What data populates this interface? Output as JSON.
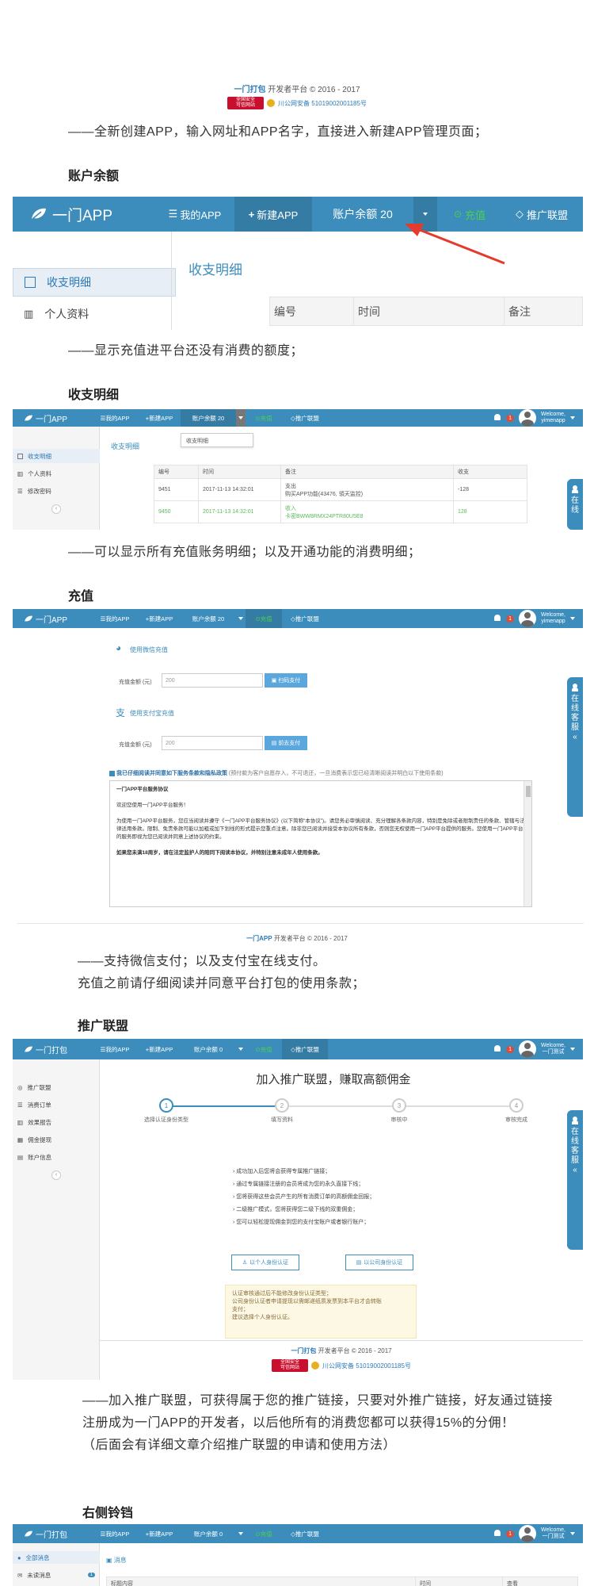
{
  "footer1": {
    "brand": "一门打包",
    "text": "开发者平台 © 2016 - 2017",
    "gov_badge": "全国安全\n可信网站",
    "beian": "川公网安备 51019002001185号"
  },
  "intro_text": "——全新创建APP，输入网址和APP名字，直接进入新建APP管理页面；",
  "balance": {
    "heading": "账户余额",
    "nav": {
      "logo": "一门APP",
      "my_app": "我的APP",
      "new_app": "新建APP",
      "balance": "账户余额 20",
      "recharge": "充值",
      "affiliate": "推广联盟"
    },
    "sidebar": [
      "收支明细",
      "个人资料"
    ],
    "content_title": "收支明细",
    "table_headers": [
      "编号",
      "时间",
      "备注"
    ],
    "desc": "——显示充值进平台还没有消费的额度；"
  },
  "ledger": {
    "heading": "收支明细",
    "nav": {
      "logo": "一门APP",
      "my_app": "我的APP",
      "new_app": "新建APP",
      "balance": "账户余额 20",
      "recharge": "充值",
      "affiliate": "推广联盟",
      "badge": "1",
      "welcome": "Welcome,",
      "user": "yimenapp"
    },
    "dropdown": "收支明细",
    "sidebar": [
      "收支明细",
      "个人资料",
      "修改密码"
    ],
    "content_title": "收支明细",
    "table_headers": [
      "编号",
      "时间",
      "备注",
      "收支"
    ],
    "rows": [
      {
        "id": "9451",
        "time": "2017-11-13 14:32:01",
        "note1": "支出",
        "note2": "购买APP功能(43476, 領天监控)",
        "amount": "-128"
      },
      {
        "id": "9450",
        "time": "2017-11-13 14:32:01",
        "note1": "收入",
        "note2": "卡密BWW8RMX24PTR80U5E8",
        "amount": "128"
      }
    ],
    "float_tab": [
      "在",
      "线"
    ],
    "desc": "——可以显示所有充值账务明细；以及开通功能的消费明细；"
  },
  "recharge": {
    "heading": "充值",
    "nav": {
      "logo": "一门APP",
      "my_app": "我的APP",
      "new_app": "新建APP",
      "balance": "账户余额 20",
      "recharge": "充值",
      "affiliate": "推广联盟",
      "badge": "1",
      "welcome": "Welcome,",
      "user": "yimenapp"
    },
    "wechat_label": "使用微信充值",
    "alipay_label": "使用支付宝充值",
    "amount_label": "充值金额 (元)",
    "amount_placeholder": "200",
    "wechat_btn": "扫码支付",
    "alipay_btn": "前去支付",
    "agree_text": "我已仔细阅读并同意如下服务条款和隐私政策",
    "agree_note": "(预付款为客户自愿存入，不可退还，一旦消费表示您已经清晰阅读并明白以下使用条款)",
    "terms_title": "一门APP平台服务协议",
    "terms_p1": "欢迎您使用一门APP平台服务！",
    "terms_p2": "为使用一门APP平台服务，您应当阅读并遵守《一门APP平台服务协议》(以下简称“本协议”)。请您务必审慎阅读、充分理解各条款内容，特别是免除或者限制责任的条款、管辖与法律适用条款。限制、免责条款可能以加粗或加下划线的形式提示您重点注意。除非您已阅读并接受本协议所有条款，否则您无权使用一门APP平台提供的服务。您使用一门APP平台的服务即视为您已阅读并同意上述协议的约束。",
    "terms_p3": "如果您未满18周岁，请在法定监护人的陪同下阅读本协议，并特别注意未成年人使用条款。",
    "float_tab": [
      "在",
      "线",
      "客",
      "服",
      "«"
    ],
    "footer_brand": "一门APP",
    "footer_text": "开发者平台 © 2016 - 2017",
    "desc1": "——支持微信支付；以及支付宝在线支付。",
    "desc2": "充值之前请仔细阅读并同意平台打包的使用条款；"
  },
  "affiliate": {
    "heading": "推广联盟",
    "nav": {
      "logo": "一门打包",
      "my_app": "我的APP",
      "new_app": "新建APP",
      "balance": "账户余额 0",
      "recharge": "充值",
      "affiliate": "推广联盟",
      "badge": "1",
      "welcome": "Welcome,",
      "user": "一门测试"
    },
    "sidebar": [
      "推广联盟",
      "消费订单",
      "效果报告",
      "佣金提现",
      "账户信息"
    ],
    "page_title": "加入推广联盟，赚取高额佣金",
    "steps": [
      {
        "num": "1",
        "label": "选择认证身份类型"
      },
      {
        "num": "2",
        "label": "填写资料"
      },
      {
        "num": "3",
        "label": "审核中"
      },
      {
        "num": "4",
        "label": "审核完成"
      }
    ],
    "bullets": [
      "成功加入后您将会获得专属推广链接；",
      "通过专属链接注册的会员将成为您的永久直接下线；",
      "您将获得这些会员产生的所有消费订单的高额佣金回报；",
      "二级推广模式，您将获得您二级下线的双重佣金；",
      "您可以轻松提现佣金到您的支付宝账户或者银行账户；"
    ],
    "personal_btn": "以个人身份认证",
    "company_btn": "以公司身份认证",
    "notice": [
      "认证审核通过后不能修改身份认证类型；",
      "公司身份认证者申请提现以需邮递纸质发票到本平台才会转账",
      "支付；",
      "建议选择个人身份认证。"
    ],
    "float_tab": [
      "在",
      "线",
      "客",
      "服",
      "«"
    ],
    "footer_brand": "一门打包",
    "footer_text": "开发者平台 © 2016 - 2017",
    "beian": "川公网安备 51019002001185号",
    "gov_badge": "全国安全\n可信网站",
    "desc1": "——加入推广联盟，可获得属于您的推广链接，只要对外推广链接，好友通过链接",
    "desc2": "注册成为一门APP的开发者，以后他所有的消费您都可以获得15%的分佣！",
    "desc3": "（后面会有详细文章介绍推广联盟的申请和使用方法）"
  },
  "bell_section": {
    "heading": "右侧铃铛",
    "nav": {
      "logo": "一门打包",
      "my_app": "我的APP",
      "new_app": "新建APP",
      "balance": "账户余额 0",
      "recharge": "充值",
      "affiliate": "推广联盟",
      "badge": "1",
      "welcome": "Welcome,",
      "user": "一门测试"
    },
    "sidebar": [
      "全部消息",
      "未读消息"
    ],
    "sidebar_badge": "1",
    "content_title": "消息",
    "table_headers": [
      "标题内容",
      "时间",
      "查看"
    ]
  }
}
